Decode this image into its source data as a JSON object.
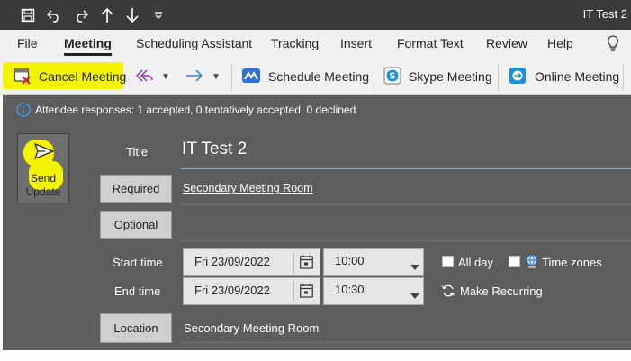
{
  "window": {
    "title": "IT Test 2"
  },
  "quick_access": {
    "save_icon": "save-icon",
    "undo_icon": "undo-icon",
    "redo_icon": "redo-icon",
    "up_icon": "arrow-up-icon",
    "down_icon": "arrow-down-icon",
    "customize_icon": "customize-icon"
  },
  "menu": {
    "tabs": [
      "File",
      "Meeting",
      "Scheduling Assistant",
      "Tracking",
      "Insert",
      "Format Text",
      "Review",
      "Help"
    ],
    "active": "Meeting"
  },
  "ribbon": {
    "cancel_meeting": "Cancel Meeting",
    "schedule_meeting": "Schedule Meeting",
    "skype_meeting": "Skype Meeting",
    "online_meeting": "Online Meeting"
  },
  "info": {
    "text": "Attendee responses: 1 accepted, 0 tentatively accepted, 0 declined."
  },
  "send": {
    "line1": "Send",
    "line2": "Update"
  },
  "form": {
    "title_label": "Title",
    "title_value": "IT Test 2",
    "required_label": "Required",
    "required_value": "Secondary Meeting Room",
    "optional_label": "Optional",
    "start_label": "Start time",
    "start_date": "Fri 23/09/2022",
    "start_time": "10:00",
    "end_label": "End time",
    "end_date": "Fri 23/09/2022",
    "end_time": "10:30",
    "all_day": "All day",
    "time_zones": "Time zones",
    "make_recurring": "Make Recurring",
    "location_label": "Location",
    "location_value": "Secondary Meeting Room"
  },
  "colors": {
    "title_bar": "#3a3a3a",
    "ribbon_bg": "#f1f1f1",
    "form_bg": "#5d5d5d",
    "highlight": "#f4f400",
    "info_blue": "#3aa0ff"
  }
}
